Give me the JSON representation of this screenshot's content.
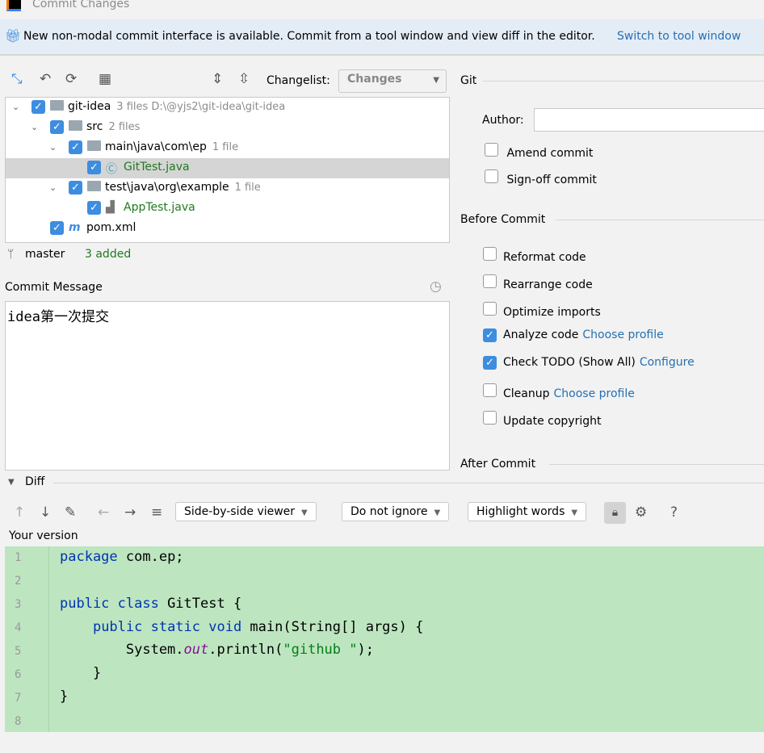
{
  "window": {
    "title": "Commit Changes"
  },
  "banner": {
    "text": "New non-modal commit interface is available. Commit from a tool window and view diff in the editor.",
    "link": "Switch to tool window"
  },
  "toolbar": {
    "changelist_label": "Changelist:",
    "changelist_value": "Changes"
  },
  "tree": [
    {
      "name": "git-idea",
      "meta": "3 files  D:\\@yjs2\\git-idea\\git-idea",
      "type": "module",
      "indent": 0,
      "expand": true
    },
    {
      "name": "src",
      "meta": "2 files",
      "type": "folder",
      "indent": 1,
      "expand": true
    },
    {
      "name": "main\\java\\com\\ep",
      "meta": "1 file",
      "type": "folder",
      "indent": 2,
      "expand": true
    },
    {
      "name": "GitTest.java",
      "meta": "",
      "type": "java-class",
      "indent": 3,
      "selected": true
    },
    {
      "name": "test\\java\\org\\example",
      "meta": "1 file",
      "type": "folder",
      "indent": 2,
      "expand": true
    },
    {
      "name": "AppTest.java",
      "meta": "",
      "type": "java-test",
      "indent": 3
    },
    {
      "name": "pom.xml",
      "meta": "",
      "type": "maven",
      "indent": 1
    }
  ],
  "status": {
    "branch": "master",
    "added": "3 added"
  },
  "commit_message": {
    "label": "Commit Message",
    "value": "idea第一次提交"
  },
  "git": {
    "title": "Git",
    "author_label": "Author:",
    "author_value": "",
    "amend": "Amend commit",
    "signoff": "Sign-off commit"
  },
  "before_commit": {
    "title": "Before Commit",
    "items": [
      {
        "label": "Reformat code",
        "checked": false,
        "link": ""
      },
      {
        "label": "Rearrange code",
        "checked": false,
        "link": ""
      },
      {
        "label": "Optimize imports",
        "checked": false,
        "link": ""
      },
      {
        "label": "Analyze code",
        "checked": true,
        "link": "Choose profile"
      },
      {
        "label": "Check TODO (Show All)",
        "checked": true,
        "link": "Configure"
      },
      {
        "label": "Cleanup",
        "checked": false,
        "link": "Choose profile"
      },
      {
        "label": "Update copyright",
        "checked": false,
        "link": ""
      }
    ]
  },
  "after_commit": {
    "title": "After Commit"
  },
  "diff": {
    "title": "Diff",
    "viewer": "Side-by-side viewer",
    "ignore": "Do not ignore",
    "highlight": "Highlight words",
    "help": "?",
    "version_label": "Your version",
    "line_numbers": [
      "1",
      "2",
      "3",
      "4",
      "5",
      "6",
      "7",
      "8"
    ]
  },
  "colors": {
    "added_bg": "#bde6c0",
    "accent": "#3d8de0",
    "link": "#2470b3"
  }
}
